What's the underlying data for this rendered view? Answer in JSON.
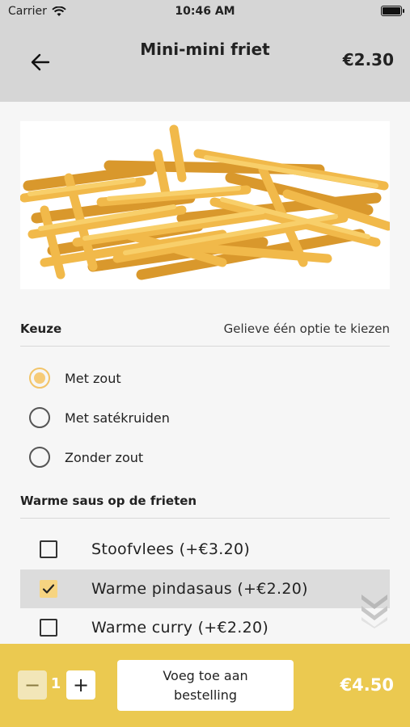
{
  "status": {
    "carrier": "Carrier",
    "time": "10:46 AM"
  },
  "header": {
    "title": "Mini-mini friet",
    "price": "€2.30"
  },
  "choice": {
    "title": "Keuze",
    "hint": "Gelieve één optie te kiezen",
    "options": [
      {
        "label": "Met zout",
        "selected": true
      },
      {
        "label": "Met satékruiden",
        "selected": false
      },
      {
        "label": "Zonder zout",
        "selected": false
      }
    ]
  },
  "sauce": {
    "title": "Warme saus op de frieten",
    "options": [
      {
        "label": "Stoofvlees (+€3.20)",
        "checked": false
      },
      {
        "label": "Warme pindasaus (+€2.20)",
        "checked": true
      },
      {
        "label": "Warme curry (+€2.20)",
        "checked": false
      }
    ]
  },
  "footer": {
    "minus": "−",
    "plus": "+",
    "quantity": "1",
    "add_label": "Voeg toe aan bestelling",
    "total": "€4.50"
  },
  "colors": {
    "accent": "#ebc950",
    "radio_selected": "#f6cb77",
    "header_bg": "#d6d6d6"
  }
}
